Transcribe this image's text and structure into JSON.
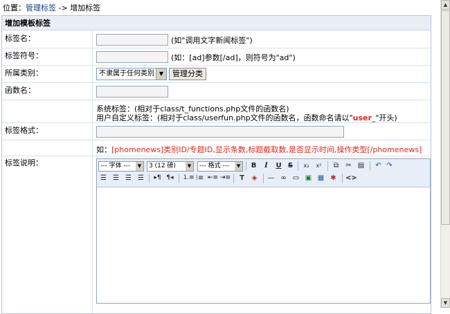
{
  "breadcrumb": {
    "prefix": "位置：",
    "link": "管理标签",
    "sep": " -> ",
    "current": "增加标签"
  },
  "form": {
    "header": "增加模板标签",
    "name": {
      "label": "标签名：",
      "value": "",
      "hint": "(如\"调用文字新闻标签\")"
    },
    "symbol": {
      "label": "标签符号：",
      "value": "",
      "hint": "(如：[ad]参数[/ad]，则符号为\"ad\")"
    },
    "category": {
      "label": "所属类别：",
      "selected": "不隶属于任何类别",
      "manage_button": "管理分类"
    },
    "func": {
      "label": "函数名：",
      "value": ""
    },
    "func_note": {
      "line1": "系统标签：(相对于class/t_functions.php文件的函数名)",
      "line2_a": "用户自定义标签：(相对于class/userfun.php文件的函数名，函数命名请以\"",
      "line2_prefix": "user_",
      "line2_b": "\"开头)"
    },
    "format": {
      "label": "标签格式：",
      "value": "",
      "example_prefix": "如：",
      "example": "[phomenews]类别ID/专题ID,显示条数,标题截取数,是否显示时间,操作类型[/phomenews]"
    },
    "desc": {
      "label": "标签说明："
    }
  },
  "editor": {
    "font_select": "--- 字体 ---",
    "size_select": "3 (12 磅)",
    "format_select": "--- 格式 ---",
    "content": ""
  }
}
